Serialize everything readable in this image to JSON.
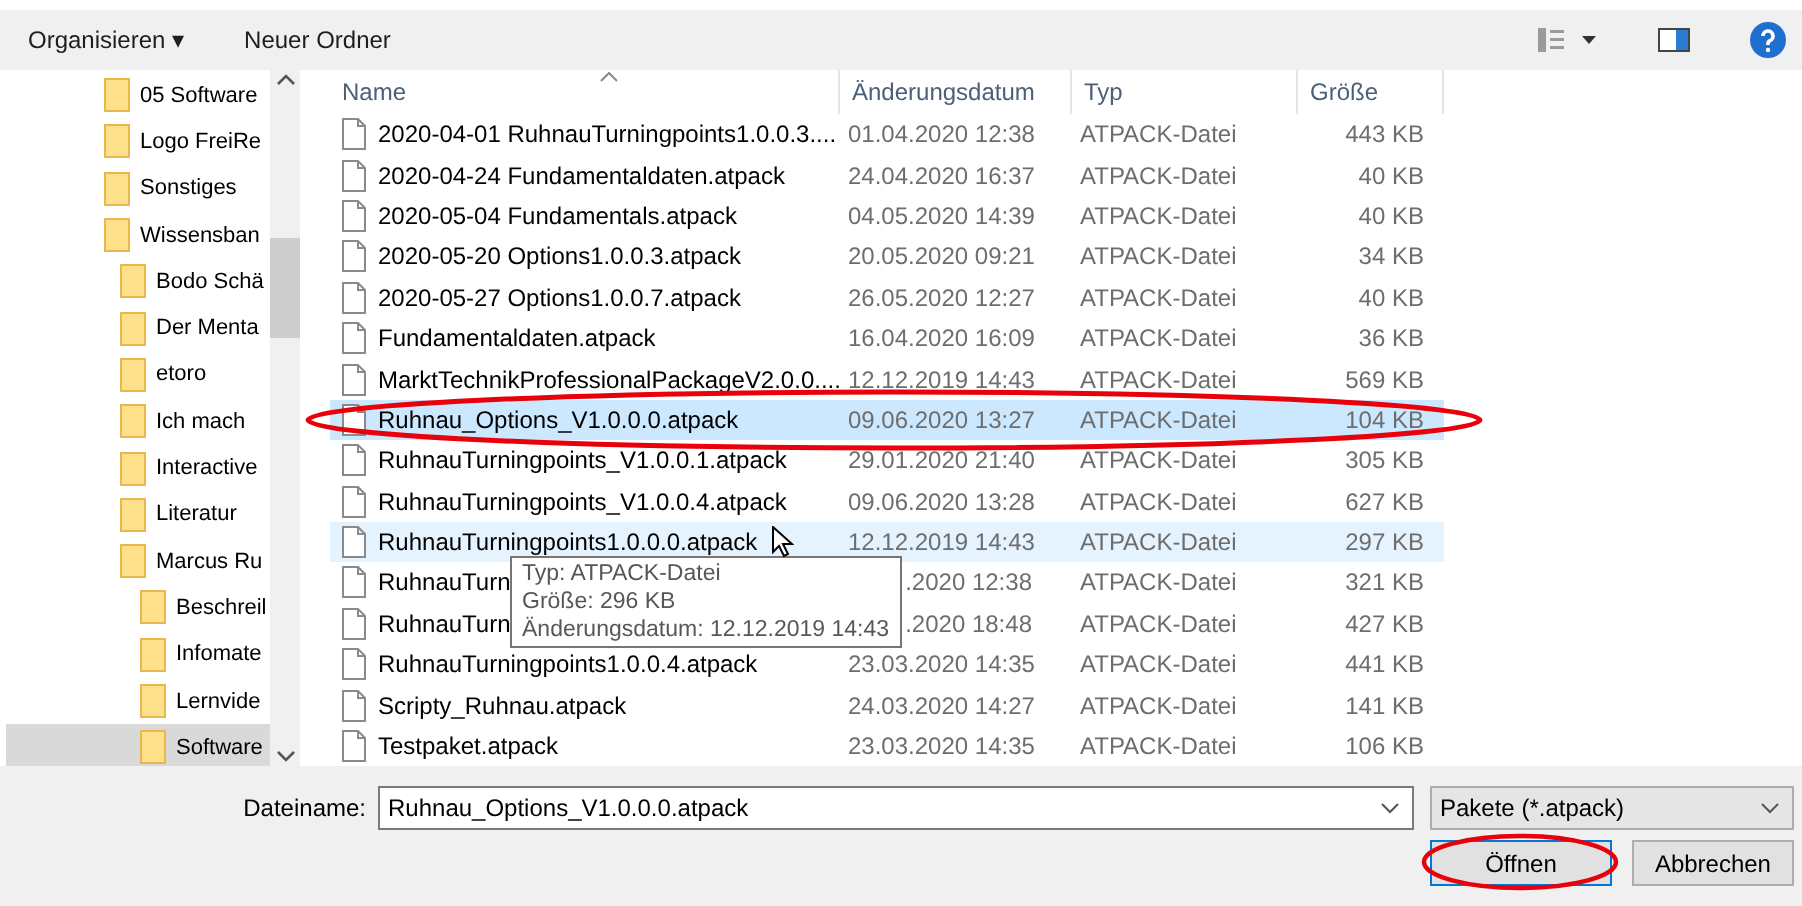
{
  "toolbar": {
    "organize": "Organisieren ▾",
    "new_folder": "Neuer Ordner"
  },
  "nav": {
    "items": [
      {
        "label": "05 Software",
        "selected": false
      },
      {
        "label": "Logo FreiRe",
        "selected": false
      },
      {
        "label": "Sonstiges",
        "selected": false
      },
      {
        "label": "Wissensban",
        "selected": false,
        "children": [
          {
            "label": "Bodo Schä",
            "selected": false
          },
          {
            "label": "Der Menta",
            "selected": false
          },
          {
            "label": "etoro",
            "selected": false
          },
          {
            "label": "Ich mach",
            "selected": false
          },
          {
            "label": "Interactive",
            "selected": false
          },
          {
            "label": "Literatur",
            "selected": false
          },
          {
            "label": "Marcus Ru",
            "selected": false,
            "children": [
              {
                "label": "Beschreil",
                "selected": false
              },
              {
                "label": "Infomate",
                "selected": false
              },
              {
                "label": "Lernvide",
                "selected": false
              },
              {
                "label": "Software",
                "selected": true
              }
            ]
          }
        ]
      }
    ]
  },
  "table": {
    "columns": [
      "Name",
      "Änderungsdatum",
      "Typ",
      "Größe"
    ],
    "rows": [
      {
        "name": "2020-04-01 RuhnauTurningpoints1.0.0.3....",
        "date": "01.04.2020 12:38",
        "type": "ATPACK-Datei",
        "size": "443 KB",
        "selected": false,
        "hovered": false,
        "circled": false
      },
      {
        "name": "2020-04-24 Fundamentaldaten.atpack",
        "date": "24.04.2020 16:37",
        "type": "ATPACK-Datei",
        "size": "40 KB",
        "selected": false,
        "hovered": false,
        "circled": false
      },
      {
        "name": "2020-05-04 Fundamentals.atpack",
        "date": "04.05.2020 14:39",
        "type": "ATPACK-Datei",
        "size": "40 KB",
        "selected": false,
        "hovered": false,
        "circled": false
      },
      {
        "name": "2020-05-20 Options1.0.0.3.atpack",
        "date": "20.05.2020 09:21",
        "type": "ATPACK-Datei",
        "size": "34 KB",
        "selected": false,
        "hovered": false,
        "circled": false
      },
      {
        "name": "2020-05-27 Options1.0.0.7.atpack",
        "date": "26.05.2020 12:27",
        "type": "ATPACK-Datei",
        "size": "40 KB",
        "selected": false,
        "hovered": false,
        "circled": false
      },
      {
        "name": "Fundamentaldaten.atpack",
        "date": "16.04.2020 16:09",
        "type": "ATPACK-Datei",
        "size": "36 KB",
        "selected": false,
        "hovered": false,
        "circled": false
      },
      {
        "name": "MarktTechnikProfessionalPackageV2.0.0....",
        "date": "12.12.2019 14:43",
        "type": "ATPACK-Datei",
        "size": "569 KB",
        "selected": false,
        "hovered": false,
        "circled": false
      },
      {
        "name": "Ruhnau_Options_V1.0.0.0.atpack",
        "date": "09.06.2020 13:27",
        "type": "ATPACK-Datei",
        "size": "104 KB",
        "selected": true,
        "hovered": false,
        "circled": true
      },
      {
        "name": "RuhnauTurningpoints_V1.0.0.1.atpack",
        "date": "29.01.2020 21:40",
        "type": "ATPACK-Datei",
        "size": "305 KB",
        "selected": false,
        "hovered": false,
        "circled": false
      },
      {
        "name": "RuhnauTurningpoints_V1.0.0.4.atpack",
        "date": "09.06.2020 13:28",
        "type": "ATPACK-Datei",
        "size": "627 KB",
        "selected": false,
        "hovered": false,
        "circled": false
      },
      {
        "name": "RuhnauTurningpoints1.0.0.0.atpack",
        "date": "12.12.2019 14:43",
        "type": "ATPACK-Datei",
        "size": "297 KB",
        "selected": false,
        "hovered": true,
        "circled": false
      },
      {
        "name": "RuhnauTurn",
        "date": ".2020 12:38",
        "type": "ATPACK-Datei",
        "size": "321 KB",
        "selected": false,
        "hovered": false,
        "circled": false
      },
      {
        "name": "RuhnauTurn",
        "date": ".2020 18:48",
        "type": "ATPACK-Datei",
        "size": "427 KB",
        "selected": false,
        "hovered": false,
        "circled": false
      },
      {
        "name": "RuhnauTurningpoints1.0.0.4.atpack",
        "date": "23.03.2020 14:35",
        "type": "ATPACK-Datei",
        "size": "441 KB",
        "selected": false,
        "hovered": false,
        "circled": false
      },
      {
        "name": "Scripty_Ruhnau.atpack",
        "date": "24.03.2020 14:27",
        "type": "ATPACK-Datei",
        "size": "141 KB",
        "selected": false,
        "hovered": false,
        "circled": false
      },
      {
        "name": "Testpaket.atpack",
        "date": "23.03.2020 14:35",
        "type": "ATPACK-Datei",
        "size": "106 KB",
        "selected": false,
        "hovered": false,
        "circled": false
      }
    ]
  },
  "tooltip": {
    "lines": [
      "Typ: ATPACK-Datei",
      "Größe: 296 KB",
      "Änderungsdatum: 12.12.2019 14:43"
    ]
  },
  "footer": {
    "filename_label": "Dateiname:",
    "filename_value": "Ruhnau_Options_V1.0.0.0.atpack",
    "filter": "Pakete (*.atpack)",
    "buttons": [
      {
        "label": "Öffnen",
        "circled": true
      },
      {
        "label": "Abbrechen",
        "circled": false
      }
    ]
  }
}
